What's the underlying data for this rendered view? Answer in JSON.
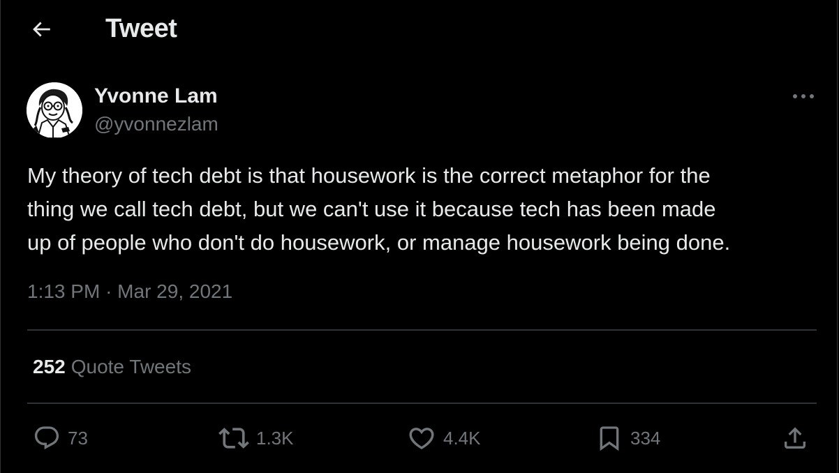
{
  "header": {
    "title": "Tweet",
    "back_icon": "arrow-left-icon"
  },
  "author": {
    "name": "Yvonne Lam",
    "handle": "@yvonnezlam",
    "avatar_icon": "avatar-illustration"
  },
  "more_icon": "more-horizontal-icon",
  "tweet": {
    "text": "My theory of tech debt is that housework is the correct metaphor for the\nthing we call tech debt, but we can't use it because tech has been made\nup of people who don't do housework, or manage housework being done.",
    "time": "1:13 PM",
    "separator": "·",
    "date": "Mar 29, 2021"
  },
  "stats": {
    "quote_count": "252",
    "quote_label": "Quote Tweets"
  },
  "actions": {
    "reply": {
      "icon": "reply-icon",
      "count": "73"
    },
    "retweet": {
      "icon": "retweet-icon",
      "count": "1.3K"
    },
    "like": {
      "icon": "heart-icon",
      "count": "4.4K"
    },
    "bookmark": {
      "icon": "bookmark-icon",
      "count": "334"
    },
    "share": {
      "icon": "share-icon"
    }
  },
  "colors": {
    "background": "#000000",
    "text_primary": "#e7e9ea",
    "text_secondary": "#71767b",
    "divider": "#2f3336"
  }
}
